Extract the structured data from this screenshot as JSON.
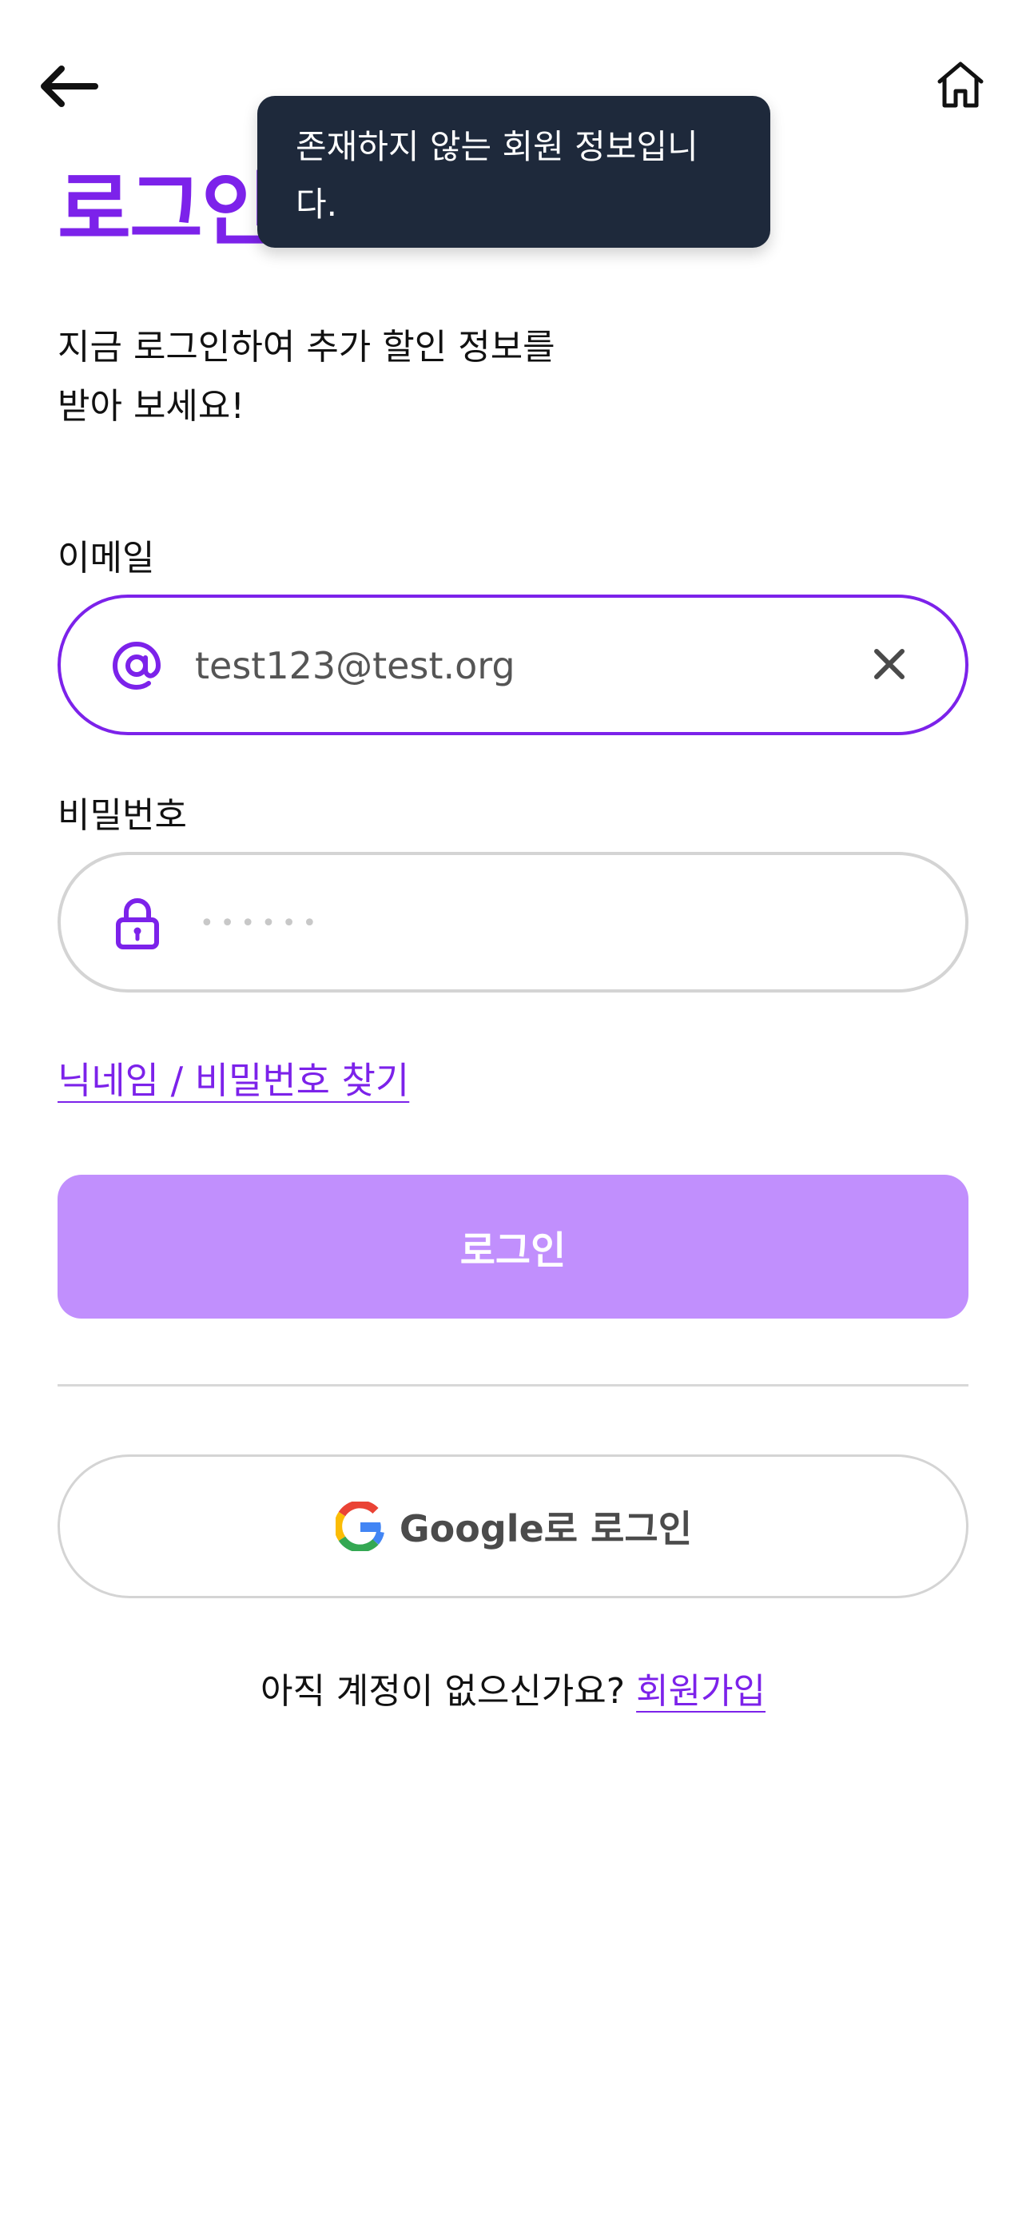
{
  "nav": {
    "back_icon": "arrow-left-icon",
    "home_icon": "home-icon"
  },
  "title": "로그인",
  "toast": {
    "message_line1": "존재하지 않는 회원 정보입니",
    "message_line2": "다."
  },
  "subtitle": {
    "line1": "지금 로그인하여 추가 할인 정보를",
    "line2": "받아 보세요!"
  },
  "email": {
    "label": "이메일",
    "value": "test123@test.org",
    "icon": "at-sign-icon",
    "clear_icon": "close-icon",
    "focused": true
  },
  "password": {
    "label": "비밀번호",
    "masked_value": "••••••",
    "icon": "lock-icon"
  },
  "find_account_link": "닉네임 / 비밀번호 찾기",
  "login_button": "로그인",
  "google_button": {
    "label": "Google로 로그인",
    "icon": "google-logo-icon"
  },
  "signup": {
    "prompt": "아직 계정이 없으신가요?",
    "link": "회원가입"
  },
  "colors": {
    "accent": "#7c22ea",
    "button_disabled": "#c18ffd",
    "toast_bg": "#1e293b",
    "border": "#d4d4d4"
  }
}
